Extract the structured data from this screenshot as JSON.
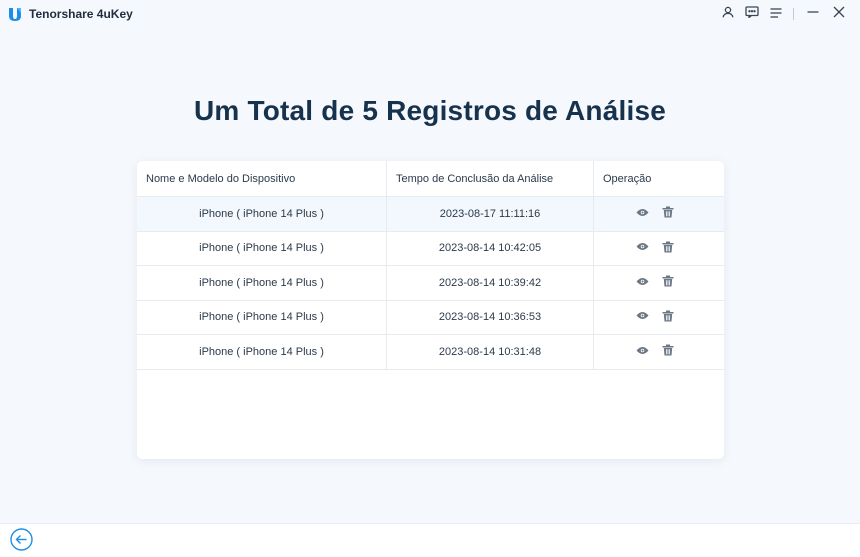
{
  "app": {
    "title": "Tenorshare 4uKey",
    "brand_color": "#1a8fe3"
  },
  "title_controls": [
    "user-icon",
    "feedback-icon",
    "menu-icon",
    "minimize-icon",
    "close-icon"
  ],
  "page": {
    "title": "Um Total de 5 Registros de Análise"
  },
  "table": {
    "columns": [
      "Nome e Modelo do Dispositivo",
      "Tempo de Conclusão da Análise",
      "Operação"
    ],
    "rows": [
      {
        "device": "iPhone ( iPhone 14 Plus )",
        "time": "2023-08-17 11:11:16"
      },
      {
        "device": "iPhone ( iPhone 14 Plus )",
        "time": "2023-08-14 10:42:05"
      },
      {
        "device": "iPhone ( iPhone 14 Plus )",
        "time": "2023-08-14 10:39:42"
      },
      {
        "device": "iPhone ( iPhone 14 Plus )",
        "time": "2023-08-14 10:36:53"
      },
      {
        "device": "iPhone ( iPhone 14 Plus )",
        "time": "2023-08-14 10:31:48"
      }
    ],
    "row_actions": [
      "eye-icon",
      "trash-icon"
    ],
    "highlight_color": "#f2f8fd"
  },
  "footer": {
    "back_icon": "back-arrow-icon",
    "accent_color": "#1a8fe3"
  }
}
